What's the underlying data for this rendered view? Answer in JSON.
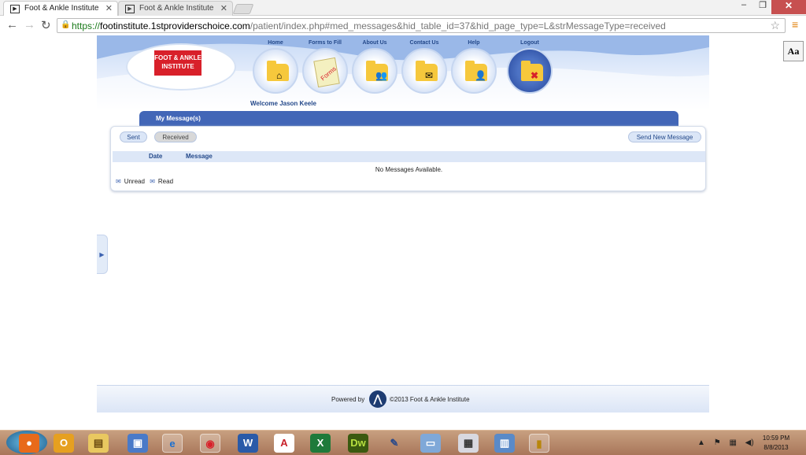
{
  "browser": {
    "tabs": [
      {
        "title": "Foot & Ankle Institute",
        "active": true
      },
      {
        "title": "Foot & Ankle Institute",
        "active": false
      }
    ],
    "url_scheme": "https://",
    "url_host": "footinstitute.1stproviderschoice.com",
    "url_path": "/patient/index.php#med_messages&hid_table_id=37&hid_page_type=L&strMessageType=received",
    "reader_button": "Aa"
  },
  "site": {
    "logo_line1": "FOOT & ANKLE",
    "logo_line2": "INSTITUTE",
    "nav": [
      {
        "label": "Home",
        "icon": "home-folder-icon"
      },
      {
        "label": "Forms to Fill",
        "icon": "forms-icon"
      },
      {
        "label": "About Us",
        "icon": "about-folder-icon"
      },
      {
        "label": "Contact Us",
        "icon": "contact-folder-icon"
      },
      {
        "label": "Help",
        "icon": "help-folder-icon"
      },
      {
        "label": "Logout",
        "icon": "logout-folder-icon"
      }
    ],
    "forms_word": "Forms",
    "welcome": "Welcome Jason Keele"
  },
  "messages": {
    "title": "My Message(s)",
    "sent_label": "Sent",
    "received_label": "Received",
    "send_new_label": "Send New Message",
    "columns": [
      "Date",
      "Message"
    ],
    "empty_text": "No Messages Available.",
    "legend_unread": "Unread",
    "legend_read": "Read"
  },
  "footer": {
    "powered_by": "Powered by",
    "copyright": "©2013 Foot & Ankle Institute"
  },
  "taskbar": {
    "apps": [
      "firefox",
      "outlook",
      "explorer",
      "network",
      "internet-explorer",
      "chrome",
      "word",
      "acrobat",
      "excel",
      "dreamweaver",
      "paint",
      "notepad",
      "calculator",
      "remote-desktop",
      "archive"
    ],
    "time": "10:59 PM",
    "date": "8/8/2013"
  },
  "colors": {
    "accent": "#4266b7",
    "logo_red": "#d8202a",
    "nav_text": "#24498a"
  }
}
